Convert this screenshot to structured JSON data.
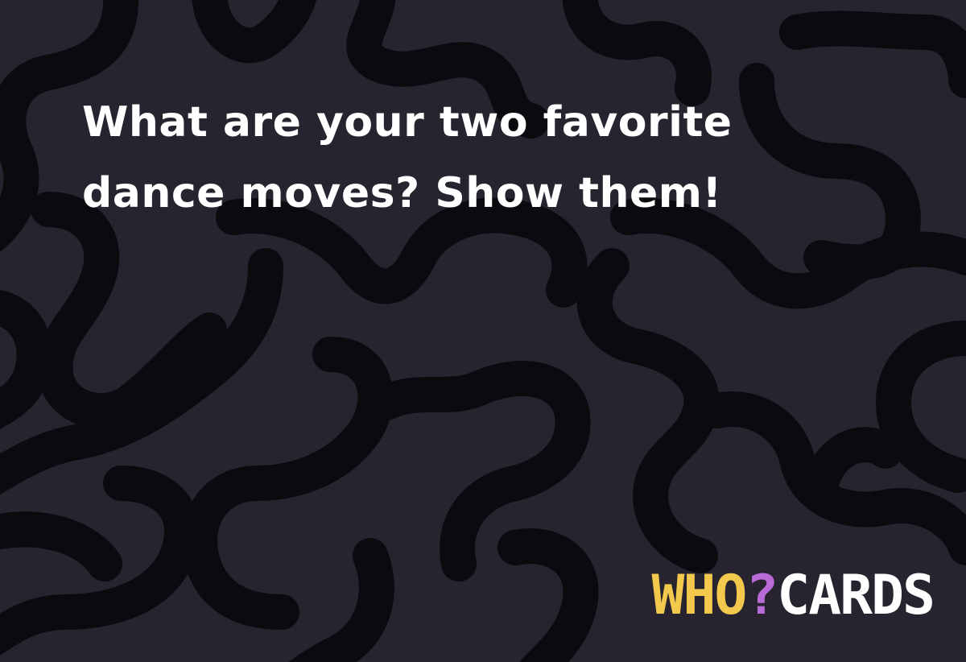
{
  "card": {
    "question_lines": [
      "What are your two favorite",
      "dance moves? Show them!"
    ]
  },
  "logo": {
    "who": "WHO",
    "mark": "?",
    "cards": "CARDS"
  },
  "colors": {
    "background": "#27232f",
    "pattern": "#0b0a0f",
    "text": "#ffffff",
    "logo_who": "#f2c94c",
    "logo_mark": "#b86bd6",
    "logo_cards": "#ffffff"
  }
}
